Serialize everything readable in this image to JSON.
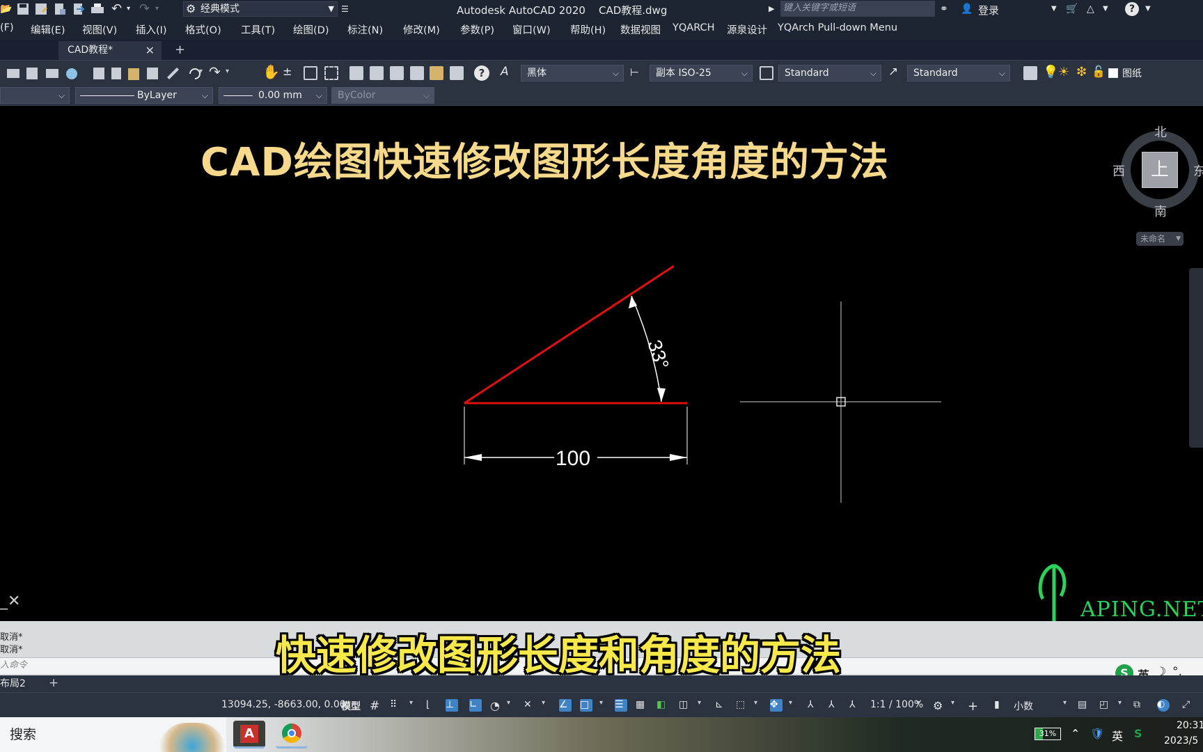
{
  "titlebar": {
    "workspace": "经典模式",
    "app_title": "Autodesk AutoCAD 2020    CAD教程.dwg",
    "search_placeholder": "键入关键字或短语",
    "login": "登录"
  },
  "menu": [
    "(F)",
    "编辑(E)",
    "视图(V)",
    "插入(I)",
    "格式(O)",
    "工具(T)",
    "绘图(D)",
    "标注(N)",
    "修改(M)",
    "参数(P)",
    "窗口(W)",
    "帮助(H)",
    "数据视图",
    "YQARCH",
    "源泉设计",
    "YQArch Pull-down Menu"
  ],
  "tabs": {
    "active": "CAD教程*",
    "close": "✕",
    "add": "+"
  },
  "toolbar1": {
    "text_font": "黑体",
    "dim_style": "副本 ISO-25",
    "table_style": "Standard",
    "multileader_style": "Standard",
    "layer_label": "图纸"
  },
  "toolbar2": {
    "linetype": "ByLayer",
    "lineweight": "0.00 mm",
    "plotstyle": "ByColor"
  },
  "video_title": "CAD绘图快速修改图形长度角度的方法",
  "drawing": {
    "angle_label": "33°",
    "length_label": "100",
    "line_color": "#e01010"
  },
  "viewcube": {
    "north": "北",
    "south": "南",
    "west": "西",
    "east": "东",
    "face": "上",
    "ucs": "未命名"
  },
  "command": {
    "history": [
      "取消*",
      "取消*"
    ],
    "placeholder": "入命令"
  },
  "subtitle": "快速修改图形长度和角度的方法",
  "layout_tabs": {
    "tab": "布局2",
    "add": "+"
  },
  "statusbar": {
    "coords": "13094.25, -8663.00, 0.00",
    "model": "模型",
    "scale": "1:1 / 100%",
    "units": "小数"
  },
  "taskbar": {
    "search": "搜索",
    "battery": "31%",
    "ime": "英",
    "time": "20:31",
    "date": "2023/5"
  },
  "ime_bar": {
    "lang": "英"
  },
  "watermark": {
    "text": "APING.NET"
  },
  "colors": {
    "accent": "#3f82c6",
    "title_yellow": "#f6d98a",
    "subtitle_yellow": "#f7e94a",
    "watermark_green": "#2ad35c"
  }
}
